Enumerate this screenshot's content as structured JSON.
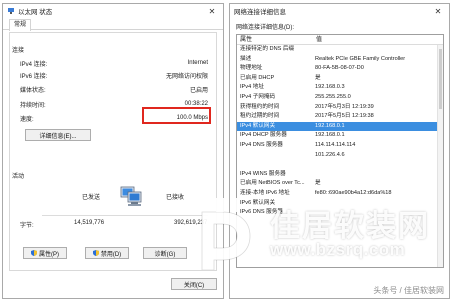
{
  "status_window": {
    "title": "以太网 状态",
    "tab": "常规",
    "connection_section": "连接",
    "rows": [
      {
        "label": "IPv4 连接:",
        "value": "Internet"
      },
      {
        "label": "IPv6 连接:",
        "value": "无网络访问权限"
      },
      {
        "label": "媒体状态:",
        "value": "已启用"
      },
      {
        "label": "持续时间:",
        "value": "00:38:22"
      },
      {
        "label": "速度:",
        "value": "100.0 Mbps"
      }
    ],
    "details_button": "详细信息(E)...",
    "activity_section": "活动",
    "sent_label": "已发送",
    "received_label": "已接收",
    "bytes_label": "字节:",
    "bytes_sent": "14,519,776",
    "bytes_received": "392,619,237",
    "properties_button": "属性(P)",
    "disable_button": "禁用(D)",
    "diagnose_button": "诊断(G)",
    "close_button": "关闭(C)",
    "highlight_color": "#e0271e"
  },
  "details_window": {
    "title": "网络连接详细信息",
    "caption": "网络连接详细信息(D):",
    "columns": [
      "属性",
      "值"
    ],
    "rows": [
      {
        "property": "连接特定的 DNS 后缀",
        "value": ""
      },
      {
        "property": "描述",
        "value": "Realtek PCIe GBE Family Controller"
      },
      {
        "property": "物理地址",
        "value": "80-FA-5B-08-07-D0"
      },
      {
        "property": "已启用 DHCP",
        "value": "是"
      },
      {
        "property": "IPv4 地址",
        "value": "192.168.0.3"
      },
      {
        "property": "IPv4 子网掩码",
        "value": "255.255.255.0"
      },
      {
        "property": "获得租约的时间",
        "value": "2017年5月3日 12:19:39"
      },
      {
        "property": "租约过期的时间",
        "value": "2017年5月5日 12:19:38"
      },
      {
        "property": "IPv4 默认网关",
        "value": "192.168.0.1",
        "selected": true
      },
      {
        "property": "IPv4 DHCP 服务器",
        "value": "192.168.0.1"
      },
      {
        "property": "IPv4 DNS 服务器",
        "value": "114.114.114.114"
      },
      {
        "property": "",
        "value": "101.226.4.6"
      },
      {
        "property": "",
        "value": ""
      },
      {
        "property": "IPv4 WINS 服务器",
        "value": ""
      },
      {
        "property": "已启用 NetBIOS over Tc...",
        "value": "是"
      },
      {
        "property": "连接-本地 IPv6 地址",
        "value": "fe80::690ae90b4a12:d6da%18"
      },
      {
        "property": "IPv6 默认网关",
        "value": ""
      },
      {
        "property": "IPv6 DNS 服务器",
        "value": ""
      }
    ],
    "selection_color": "#3b8ee0"
  },
  "watermark": {
    "name": "佳居软装网",
    "url": "www.bzsrq.com",
    "credit": "头条号 / 佳居软装网"
  }
}
